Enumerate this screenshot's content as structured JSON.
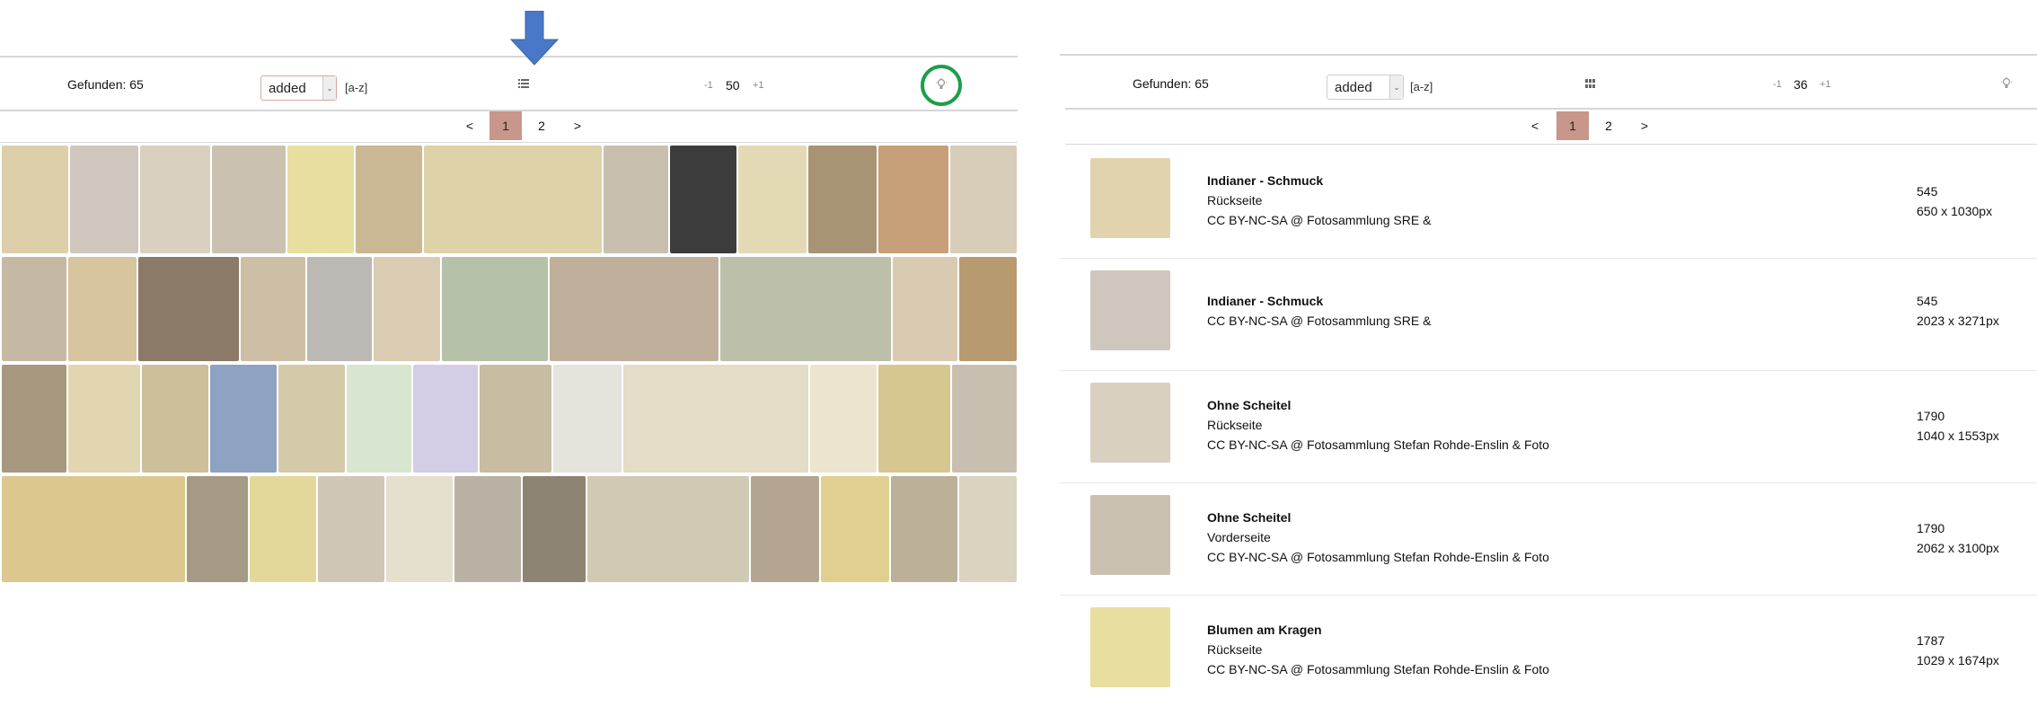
{
  "left": {
    "found_label": "Gefunden: 65",
    "sort": {
      "selected": "added",
      "direction_label": "[a-z]"
    },
    "view_icon": "list-icon",
    "zoom": {
      "minus": "-1",
      "value": "50",
      "plus": "+1"
    },
    "lightbulb_icon": "lightbulb-icon",
    "pager": {
      "prev": "<",
      "pages": [
        "1",
        "2"
      ],
      "active": "1",
      "next": ">"
    }
  },
  "right": {
    "found_label": "Gefunden: 65",
    "sort": {
      "selected": "added",
      "direction_label": "[a-z]"
    },
    "view_icon": "grid-icon",
    "zoom": {
      "minus": "-1",
      "value": "36",
      "plus": "+1"
    },
    "lightbulb_icon": "lightbulb-icon",
    "pager": {
      "prev": "<",
      "pages": [
        "1",
        "2"
      ],
      "active": "1",
      "next": ">"
    },
    "items": [
      {
        "title": "Indianer - Schmuck",
        "side": "Rückseite",
        "license": "CC BY-NC-SA @ Fotosammlung SRE &",
        "id": "545",
        "dims": "650 x 1030px"
      },
      {
        "title": "Indianer - Schmuck",
        "side": "",
        "license": "CC BY-NC-SA @ Fotosammlung SRE &",
        "id": "545",
        "dims": "2023 x 3271px"
      },
      {
        "title": "Ohne Scheitel",
        "side": "Rückseite",
        "license": "CC BY-NC-SA @ Fotosammlung Stefan Rohde-Enslin & Foto",
        "id": "1790",
        "dims": "1040 x 1553px"
      },
      {
        "title": "Ohne Scheitel",
        "side": "Vorderseite",
        "license": "CC BY-NC-SA @ Fotosammlung Stefan Rohde-Enslin & Foto",
        "id": "1790",
        "dims": "2062 x 3100px"
      },
      {
        "title": "Blumen am Kragen",
        "side": "Rückseite",
        "license": "CC BY-NC-SA @ Fotosammlung Stefan Rohde-Enslin & Foto",
        "id": "1787",
        "dims": "1029 x 1674px"
      }
    ]
  },
  "annotations": {
    "arrow_color": "#4a78c8",
    "circle_color": "#1e9e4a"
  },
  "colors": {
    "active_page": "#c8968a",
    "sort_border": "#d8a79f"
  }
}
